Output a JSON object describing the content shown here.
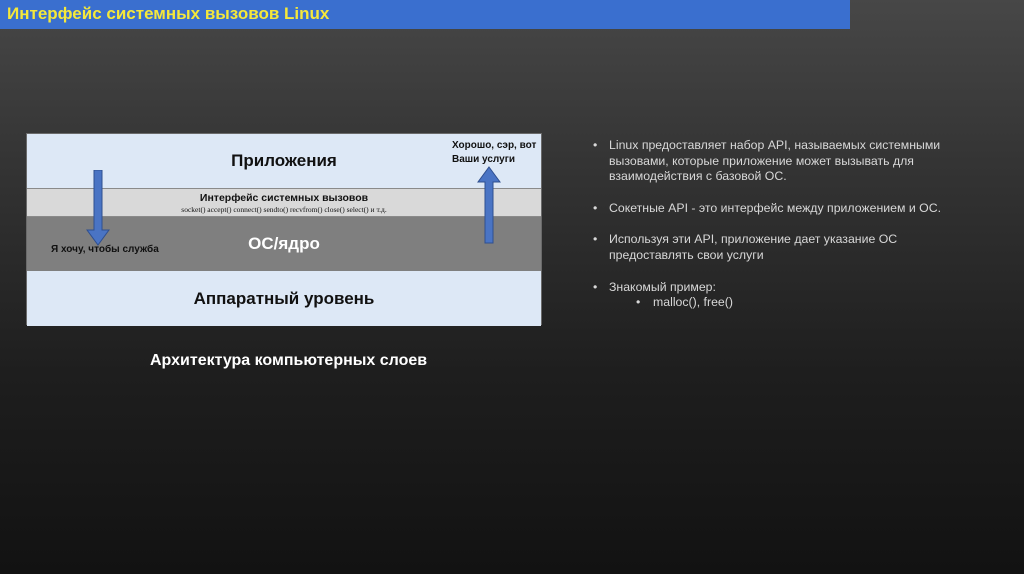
{
  "slide": {
    "title": "Интерфейс системных вызовов Linux",
    "title_color": "#f5e83a",
    "title_bar_color": "#3a6fcf"
  },
  "diagram": {
    "layers": {
      "applications": "Приложения",
      "syscall_interface": "Интерфейс системных вызовов",
      "syscall_list": "socket() accept() connect() sendto() recvfrom() close() select() и т.д.",
      "os_kernel": "ОС/ядро",
      "hardware": "Аппаратный уровень"
    },
    "colors": {
      "light_layer": "#dde8f6",
      "syscall_layer": "#d9d9d9",
      "os_layer": "#7f7f7f",
      "arrow": "#4a74c4"
    },
    "notes": {
      "request": "Я хочу, чтобы служба",
      "response_line1": "Хорошо, сэр, вот",
      "response_line2": "Ваши услуги"
    },
    "caption": "Архитектура компьютерных слоев"
  },
  "bullets": [
    {
      "text": "Linux предоставляет набор API, называемых системными вызовами, которые приложение может вызывать для взаимодействия с базовой ОС."
    },
    {
      "text": "Сокетные API - это интерфейс между приложением и ОС."
    },
    {
      "text": "Используя эти API, приложение дает указание ОС предоставлять свои услуги"
    },
    {
      "text": "Знакомый пример:",
      "sub": [
        "malloc(), free()"
      ]
    }
  ],
  "bullet_symbol": "•"
}
